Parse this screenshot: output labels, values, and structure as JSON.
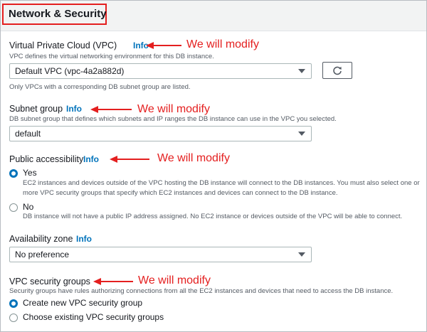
{
  "section": {
    "title": "Network & Security"
  },
  "annotation": "We will modify",
  "vpc": {
    "label": "Virtual Private Cloud (VPC)",
    "info": "Info",
    "description": "VPC defines the virtual networking environment for this DB instance.",
    "selected": "Default VPC (vpc-4a2a882d)",
    "note": "Only VPCs with a corresponding DB subnet group are listed."
  },
  "subnet": {
    "label": "Subnet group",
    "info": "Info",
    "description": "DB subnet group that defines which subnets and IP ranges the DB instance can use in the VPC you selected.",
    "selected": "default"
  },
  "public_access": {
    "label": "Public accessibility",
    "info": "Info",
    "yes_label": "Yes",
    "yes_description": "EC2 instances and devices outside of the VPC hosting the DB instance will connect to the DB instances. You must also select one or more VPC security groups that specify which EC2 instances and devices can connect to the DB instance.",
    "no_label": "No",
    "no_description": "DB instance will not have a public IP address assigned. No EC2 instance or devices outside of the VPC will be able to connect.",
    "selected": "Yes"
  },
  "availability_zone": {
    "label": "Availability zone",
    "info": "Info",
    "selected": "No preference"
  },
  "security_groups": {
    "label": "VPC security groups",
    "description": "Security groups have rules authorizing connections from all the EC2 instances and devices that need to access the DB instance.",
    "option_new": "Create new VPC security group",
    "option_existing": "Choose existing VPC security groups",
    "selected": "Create new VPC security group"
  },
  "colors": {
    "annotation": "#e41f1f",
    "link": "#0073bb",
    "radio_selected": "#0073bb"
  }
}
